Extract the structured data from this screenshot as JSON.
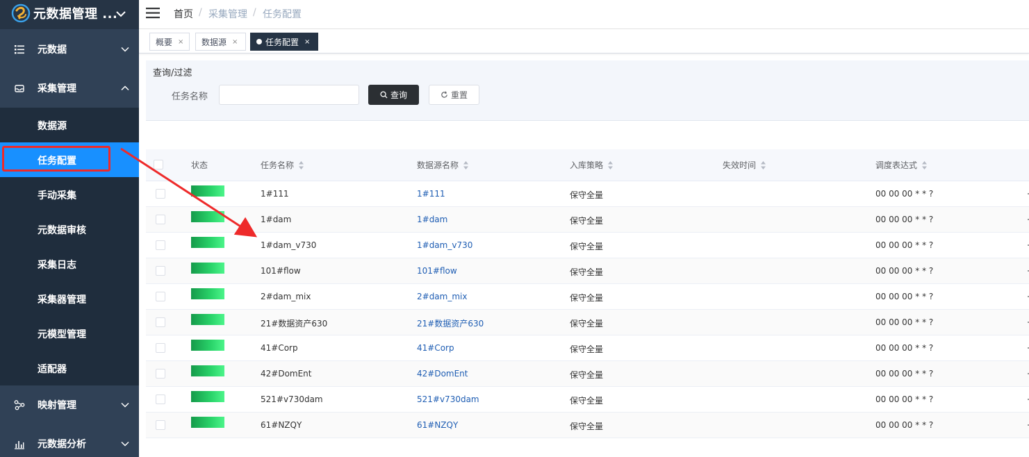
{
  "app": {
    "brand": "元数据管理 ...",
    "accent_color": "#1890ff",
    "sidebar_bg": "#304156",
    "annotation_color": "#ee2a2a"
  },
  "sidebar": {
    "items": [
      {
        "label": "元数据",
        "icon": "list-icon",
        "expanded": false
      },
      {
        "label": "采集管理",
        "icon": "inbox-icon",
        "expanded": true
      },
      {
        "label": "映射管理",
        "icon": "share-nodes-icon",
        "expanded": false
      },
      {
        "label": "元数据分析",
        "icon": "bar-chart-icon",
        "expanded": false
      }
    ],
    "subitems": [
      {
        "label": "数据源",
        "active": false
      },
      {
        "label": "任务配置",
        "active": true
      },
      {
        "label": "手动采集",
        "active": false
      },
      {
        "label": "元数据审核",
        "active": false
      },
      {
        "label": "采集日志",
        "active": false
      },
      {
        "label": "采集器管理",
        "active": false
      },
      {
        "label": "元模型管理",
        "active": false
      },
      {
        "label": "适配器",
        "active": false
      }
    ]
  },
  "breadcrumb": {
    "home": "首页",
    "sep": "/",
    "parent": "采集管理",
    "current": "任务配置"
  },
  "tags": [
    {
      "label": "概要",
      "active": false
    },
    {
      "label": "数据源",
      "active": false
    },
    {
      "label": "任务配置",
      "active": true
    }
  ],
  "tag_close": "×",
  "filter": {
    "title": "查询/过滤",
    "task_name_label": "任务名称",
    "task_name_value": "",
    "search_label": "查询",
    "reset_label": "重置"
  },
  "table": {
    "headers": {
      "status": "状态",
      "task_name": "任务名称",
      "datasource_name": "数据源名称",
      "storage_strategy": "入库策略",
      "expire_time": "失效时间",
      "cron": "调度表达式"
    },
    "rows": [
      {
        "task_name": "1#111",
        "datasource": "1#111",
        "strategy": "保守全量",
        "expire": "",
        "cron": "00 00 00 * * ?"
      },
      {
        "task_name": "1#dam",
        "datasource": "1#dam",
        "strategy": "保守全量",
        "expire": "",
        "cron": "00 00 00 * * ?"
      },
      {
        "task_name": "1#dam_v730",
        "datasource": "1#dam_v730",
        "strategy": "保守全量",
        "expire": "",
        "cron": "00 00 00 * * ?"
      },
      {
        "task_name": "101#flow",
        "datasource": "101#flow",
        "strategy": "保守全量",
        "expire": "",
        "cron": "00 00 00 * * ?"
      },
      {
        "task_name": "2#dam_mix",
        "datasource": "2#dam_mix",
        "strategy": "保守全量",
        "expire": "",
        "cron": "00 00 00 * * ?"
      },
      {
        "task_name": "21#数据资产630",
        "datasource": "21#数据资产630",
        "strategy": "保守全量",
        "expire": "",
        "cron": "00 00 00 * * ?"
      },
      {
        "task_name": "41#Corp",
        "datasource": "41#Corp",
        "strategy": "保守全量",
        "expire": "",
        "cron": "00 00 00 * * ?"
      },
      {
        "task_name": "42#DomEnt",
        "datasource": "42#DomEnt",
        "strategy": "保守全量",
        "expire": "",
        "cron": "00 00 00 * * ?"
      },
      {
        "task_name": "521#v730dam",
        "datasource": "521#v730dam",
        "strategy": "保守全量",
        "expire": "",
        "cron": "00 00 00 * * ?"
      },
      {
        "task_name": "61#NZQY",
        "datasource": "61#NZQY",
        "strategy": "保守全量",
        "expire": "",
        "cron": "00 00 00 * * ?"
      }
    ]
  }
}
